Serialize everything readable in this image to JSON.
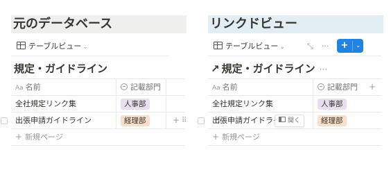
{
  "left_panel": {
    "heading": "元のデータベース",
    "view_tab": {
      "label": "テーブルビュー",
      "icon": "table-icon"
    },
    "db_title": "規定・ガイドライン",
    "columns": {
      "name": "名前",
      "dept": "記載部門"
    },
    "rows": [
      {
        "name": "全社規定リンク集",
        "dept": "人事部",
        "dept_color": "#e8deee"
      },
      {
        "name": "出張申請ガイドライン",
        "dept": "経理部",
        "dept_color": "#fadec9"
      }
    ],
    "new_page_label": "新規ページ"
  },
  "right_panel": {
    "heading": "リンクドビュー",
    "view_tab": {
      "label": "テーブルビュー",
      "icon": "table-icon"
    },
    "db_title": "規定・ガイドライン",
    "columns": {
      "name": "名前",
      "dept": "記載部門"
    },
    "rows": [
      {
        "name": "全社規定リンク集",
        "dept": "人事部",
        "dept_color": "#e8deee"
      },
      {
        "name": "出張申請ガイドライン",
        "dept": "経理部",
        "dept_color": "#fadec9",
        "open_label": "開く"
      }
    ],
    "new_page_label": "新規ページ",
    "new_button_color": "#2383e2"
  },
  "colors": {
    "left_heading_bg": "#efefed",
    "right_heading_bg": "#e3eef4"
  }
}
